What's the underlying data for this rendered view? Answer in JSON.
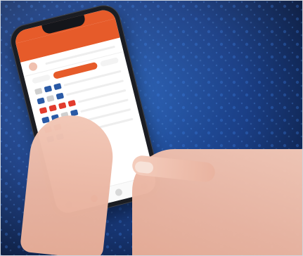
{
  "image": {
    "width": 431,
    "height": 364
  },
  "colors": {
    "app_primary": "#e65b2a",
    "background_blue": "#1d4ea0",
    "background_dark": "#0b1a3a"
  },
  "phone": {
    "app": {
      "header_title": ""
    }
  }
}
